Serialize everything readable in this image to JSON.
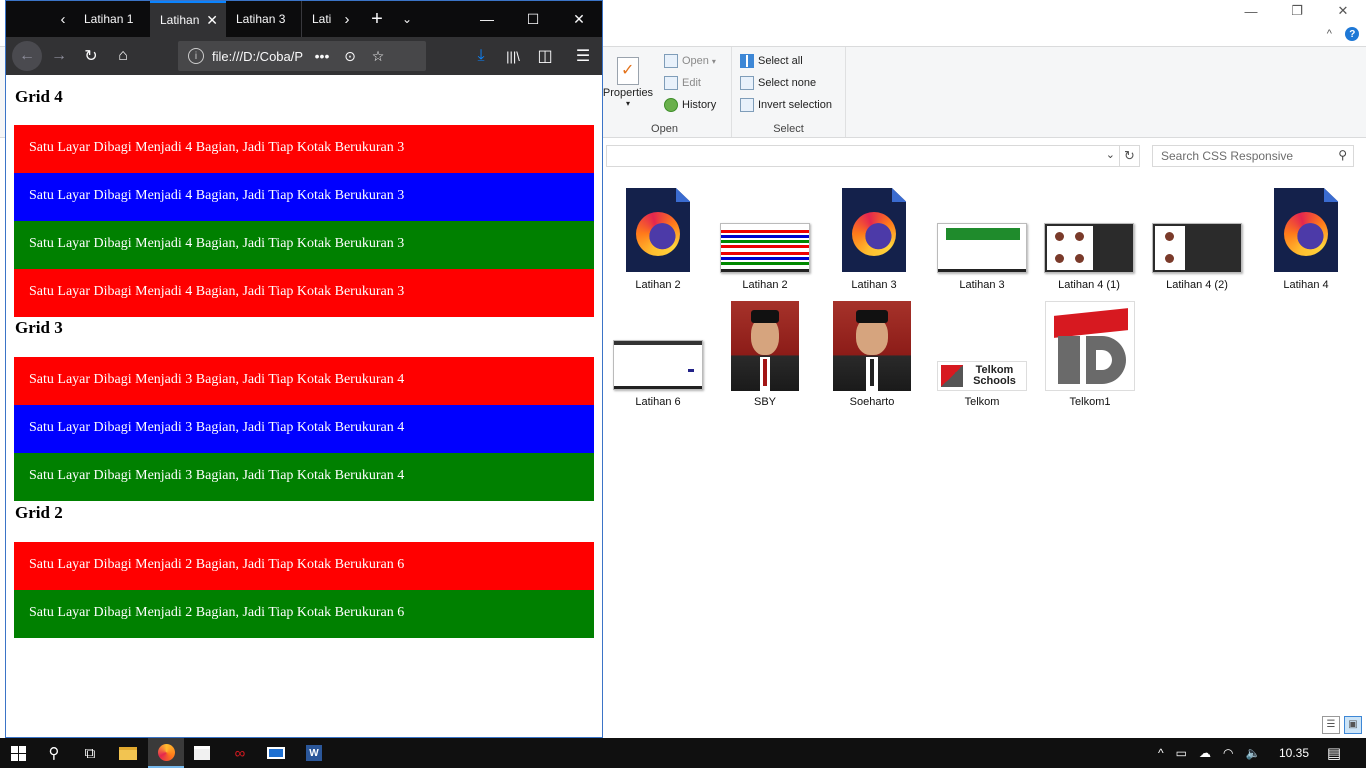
{
  "explorer": {
    "ribbon": {
      "properties_label": "Properties",
      "open_label": "Open",
      "edit_label": "Edit",
      "history_label": "History",
      "open_group_label": "Open",
      "select_all_label": "Select all",
      "select_none_label": "Select none",
      "invert_selection_label": "Invert selection",
      "select_group_label": "Select"
    },
    "search_placeholder": "Search CSS Responsive",
    "files": [
      {
        "name": "Latihan 2",
        "kind": "firefox-html"
      },
      {
        "name": "Latihan 2",
        "kind": "screenshot-stripes"
      },
      {
        "name": "Latihan 3",
        "kind": "firefox-html"
      },
      {
        "name": "Latihan 3",
        "kind": "screenshot-green"
      },
      {
        "name": "Latihan 4 (1)",
        "kind": "screenshot-dark"
      },
      {
        "name": "Latihan 4 (2)",
        "kind": "screenshot-dark"
      },
      {
        "name": "Latihan 4",
        "kind": "firefox-html"
      },
      {
        "name": "Latihan 6",
        "kind": "screenshot-white"
      },
      {
        "name": "SBY",
        "kind": "photo"
      },
      {
        "name": "Soeharto",
        "kind": "photo"
      },
      {
        "name": "Telkom",
        "kind": "logo-small"
      },
      {
        "name": "Telkom1",
        "kind": "logo-big"
      }
    ],
    "telkom_logo_text": "Telkom Schools"
  },
  "firefox": {
    "tabs": [
      {
        "label": "Latihan 1"
      },
      {
        "label": "Latihan"
      },
      {
        "label": "Latihan 3"
      },
      {
        "label": "Lati"
      }
    ],
    "url": "file:///D:/Coba/P",
    "page": {
      "grid4_title": "Grid 4",
      "grid4_boxes": [
        {
          "text": "Satu Layar Dibagi Menjadi 4 Bagian, Jadi Tiap Kotak Berukuran 3",
          "color": "#ff0000"
        },
        {
          "text": "Satu Layar Dibagi Menjadi 4 Bagian, Jadi Tiap Kotak Berukuran 3",
          "color": "#0000ff"
        },
        {
          "text": "Satu Layar Dibagi Menjadi 4 Bagian, Jadi Tiap Kotak Berukuran 3",
          "color": "#008000"
        },
        {
          "text": "Satu Layar Dibagi Menjadi 4 Bagian, Jadi Tiap Kotak Berukuran 3",
          "color": "#ff0000"
        }
      ],
      "grid3_title": "Grid 3",
      "grid3_boxes": [
        {
          "text": "Satu Layar Dibagi Menjadi 3 Bagian, Jadi Tiap Kotak Berukuran 4",
          "color": "#ff0000"
        },
        {
          "text": "Satu Layar Dibagi Menjadi 3 Bagian, Jadi Tiap Kotak Berukuran 4",
          "color": "#0000ff"
        },
        {
          "text": "Satu Layar Dibagi Menjadi 3 Bagian, Jadi Tiap Kotak Berukuran 4",
          "color": "#008000"
        }
      ],
      "grid2_title": "Grid 2",
      "grid2_boxes": [
        {
          "text": "Satu Layar Dibagi Menjadi 2 Bagian, Jadi Tiap Kotak Berukuran 6",
          "color": "#ff0000"
        },
        {
          "text": "Satu Layar Dibagi Menjadi 2 Bagian, Jadi Tiap Kotak Berukuran 6",
          "color": "#008000"
        }
      ]
    }
  },
  "taskbar": {
    "clock": "10.35",
    "accent_color": "#76b9ed"
  }
}
